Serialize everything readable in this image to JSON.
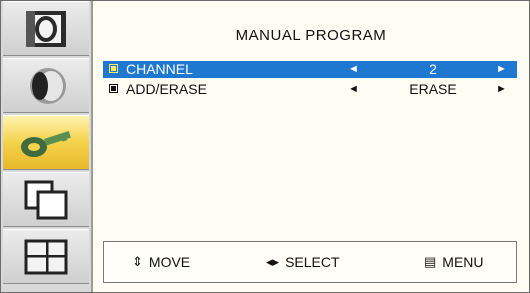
{
  "menu": {
    "title": "MANUAL PROGRAM",
    "rows": [
      {
        "label": "CHANNEL",
        "value": "2",
        "left": "◄",
        "right": "►"
      },
      {
        "label": "ADD/ERASE",
        "value": "ERASE",
        "left": "◄",
        "right": "►"
      }
    ]
  },
  "footer": {
    "move": "MOVE",
    "select": "SELECT",
    "menu": "MENU"
  },
  "sidebar": {
    "items": [
      "picture-icon",
      "sound-icon",
      "key-icon",
      "screen-icon",
      "setup-icon"
    ],
    "active_index": 2
  },
  "colors": {
    "highlight": "#1f78d0",
    "active_sidebar": "#f4d24a"
  }
}
